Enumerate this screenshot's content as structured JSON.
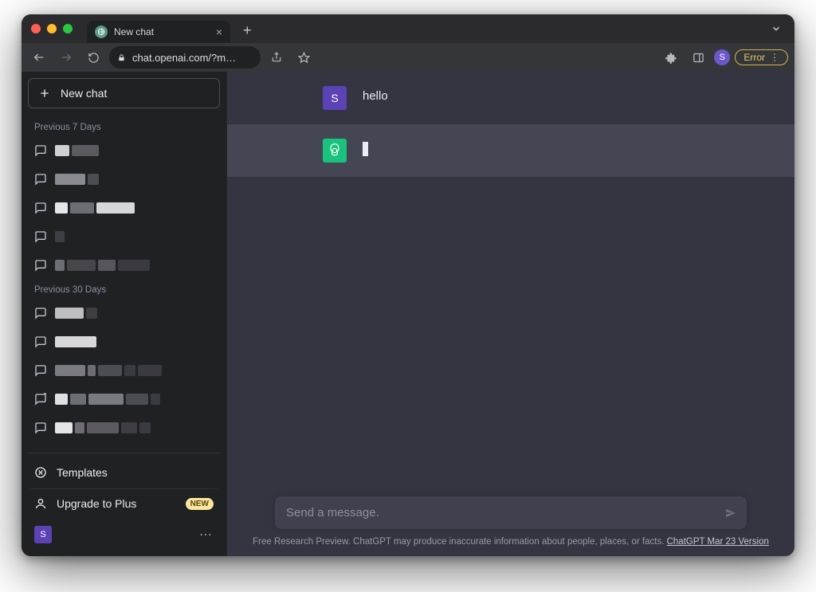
{
  "window": {
    "tab_title": "New chat",
    "url": "chat.openai.com/?m…",
    "error_label": "Error"
  },
  "sidebar": {
    "new_chat_label": "New chat",
    "section_7days_label": "Previous 7 Days",
    "section_30days_label": "Previous 30 Days",
    "templates_label": "Templates",
    "upgrade_label": "Upgrade to Plus",
    "upgrade_badge": "NEW",
    "user_initial": "S"
  },
  "chat": {
    "user_initial": "S",
    "user_message": "hello",
    "assistant_message": ""
  },
  "composer": {
    "placeholder": "Send a message."
  },
  "footer": {
    "text": "Free Research Preview. ChatGPT may produce inaccurate information about people, places, or facts. ",
    "version_link": "ChatGPT Mar 23 Version"
  },
  "colors": {
    "sidebar_bg": "#202123",
    "main_bg": "#343541",
    "assistant_bg": "#444654",
    "accent_user": "#5b42b5",
    "accent_bot": "#19c37d"
  }
}
